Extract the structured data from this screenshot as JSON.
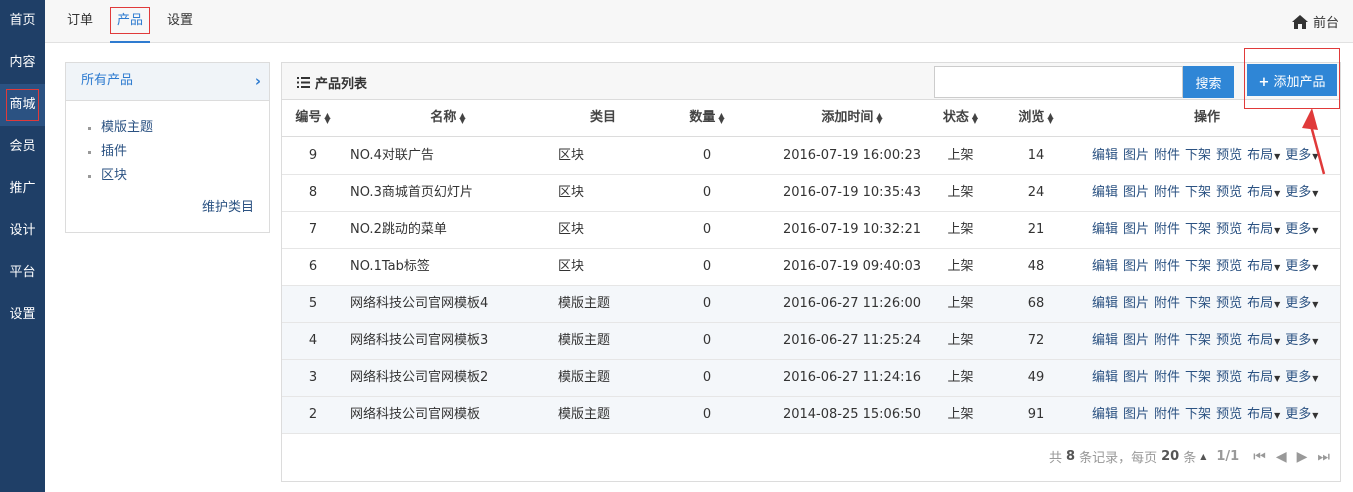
{
  "nav": {
    "items": [
      {
        "label": "首页"
      },
      {
        "label": "内容"
      },
      {
        "label": "商城"
      },
      {
        "label": "会员"
      },
      {
        "label": "推广"
      },
      {
        "label": "设计"
      },
      {
        "label": "平台"
      },
      {
        "label": "设置"
      }
    ],
    "active_index": 2
  },
  "topbar": {
    "tabs": [
      {
        "label": "订单"
      },
      {
        "label": "产品"
      },
      {
        "label": "设置"
      }
    ],
    "active_index": 1,
    "frontdesk_label": "前台"
  },
  "categories": {
    "header": "所有产品",
    "items": [
      "模版主题",
      "插件",
      "区块"
    ],
    "maintain_label": "维护类目"
  },
  "products": {
    "title": "产品列表",
    "search_button": "搜索",
    "add_button": "添加产品",
    "columns": {
      "id": "编号",
      "name": "名称",
      "category": "类目",
      "quantity": "数量",
      "added": "添加时间",
      "status": "状态",
      "views": "浏览",
      "ops": "操作"
    },
    "ops_labels": {
      "edit": "编辑",
      "image": "图片",
      "attach": "附件",
      "unlist": "下架",
      "preview": "预览",
      "layout": "布局",
      "more": "更多"
    },
    "rows": [
      {
        "id": "9",
        "name": "NO.4对联广告",
        "category": "区块",
        "quantity": "0",
        "added": "2016-07-19 16:00:23",
        "status": "上架",
        "views": "14"
      },
      {
        "id": "8",
        "name": "NO.3商城首页幻灯片",
        "category": "区块",
        "quantity": "0",
        "added": "2016-07-19 10:35:43",
        "status": "上架",
        "views": "24"
      },
      {
        "id": "7",
        "name": "NO.2跳动的菜单",
        "category": "区块",
        "quantity": "0",
        "added": "2016-07-19 10:32:21",
        "status": "上架",
        "views": "21"
      },
      {
        "id": "6",
        "name": "NO.1Tab标签",
        "category": "区块",
        "quantity": "0",
        "added": "2016-07-19 09:40:03",
        "status": "上架",
        "views": "48"
      },
      {
        "id": "5",
        "name": "网络科技公司官网模板4",
        "category": "模版主题",
        "quantity": "0",
        "added": "2016-06-27 11:26:00",
        "status": "上架",
        "views": "68"
      },
      {
        "id": "4",
        "name": "网络科技公司官网模板3",
        "category": "模版主题",
        "quantity": "0",
        "added": "2016-06-27 11:25:24",
        "status": "上架",
        "views": "72"
      },
      {
        "id": "3",
        "name": "网络科技公司官网模板2",
        "category": "模版主题",
        "quantity": "0",
        "added": "2016-06-27 11:24:16",
        "status": "上架",
        "views": "49"
      },
      {
        "id": "2",
        "name": "网络科技公司官网模板",
        "category": "模版主题",
        "quantity": "0",
        "added": "2014-08-25 15:06:50",
        "status": "上架",
        "views": "91"
      }
    ],
    "pagination": {
      "prefix": "共",
      "total": "8",
      "records_label": "条记录，每页",
      "per_page": "20",
      "per_page_suffix": "条",
      "page_info": "1/1"
    }
  },
  "colors": {
    "nav_bg": "#1f3f67",
    "accent": "#2f86d6",
    "highlight": "#e03a3a"
  }
}
